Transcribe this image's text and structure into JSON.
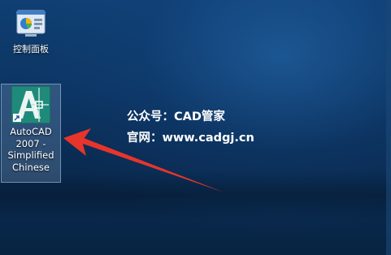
{
  "desktop": {
    "icons": [
      {
        "label": "控制面板",
        "icon": "control-panel-icon"
      },
      {
        "label_lines": [
          "AutoCAD",
          "2007 -",
          "Simplified",
          "Chinese"
        ],
        "icon": "autocad-icon",
        "selected": true
      }
    ],
    "watermark": {
      "line1": "公众号：CAD管家",
      "line2": "官网：www.cadgj.cn"
    },
    "annotation": {
      "type": "arrow",
      "color": "#e8352b"
    }
  }
}
